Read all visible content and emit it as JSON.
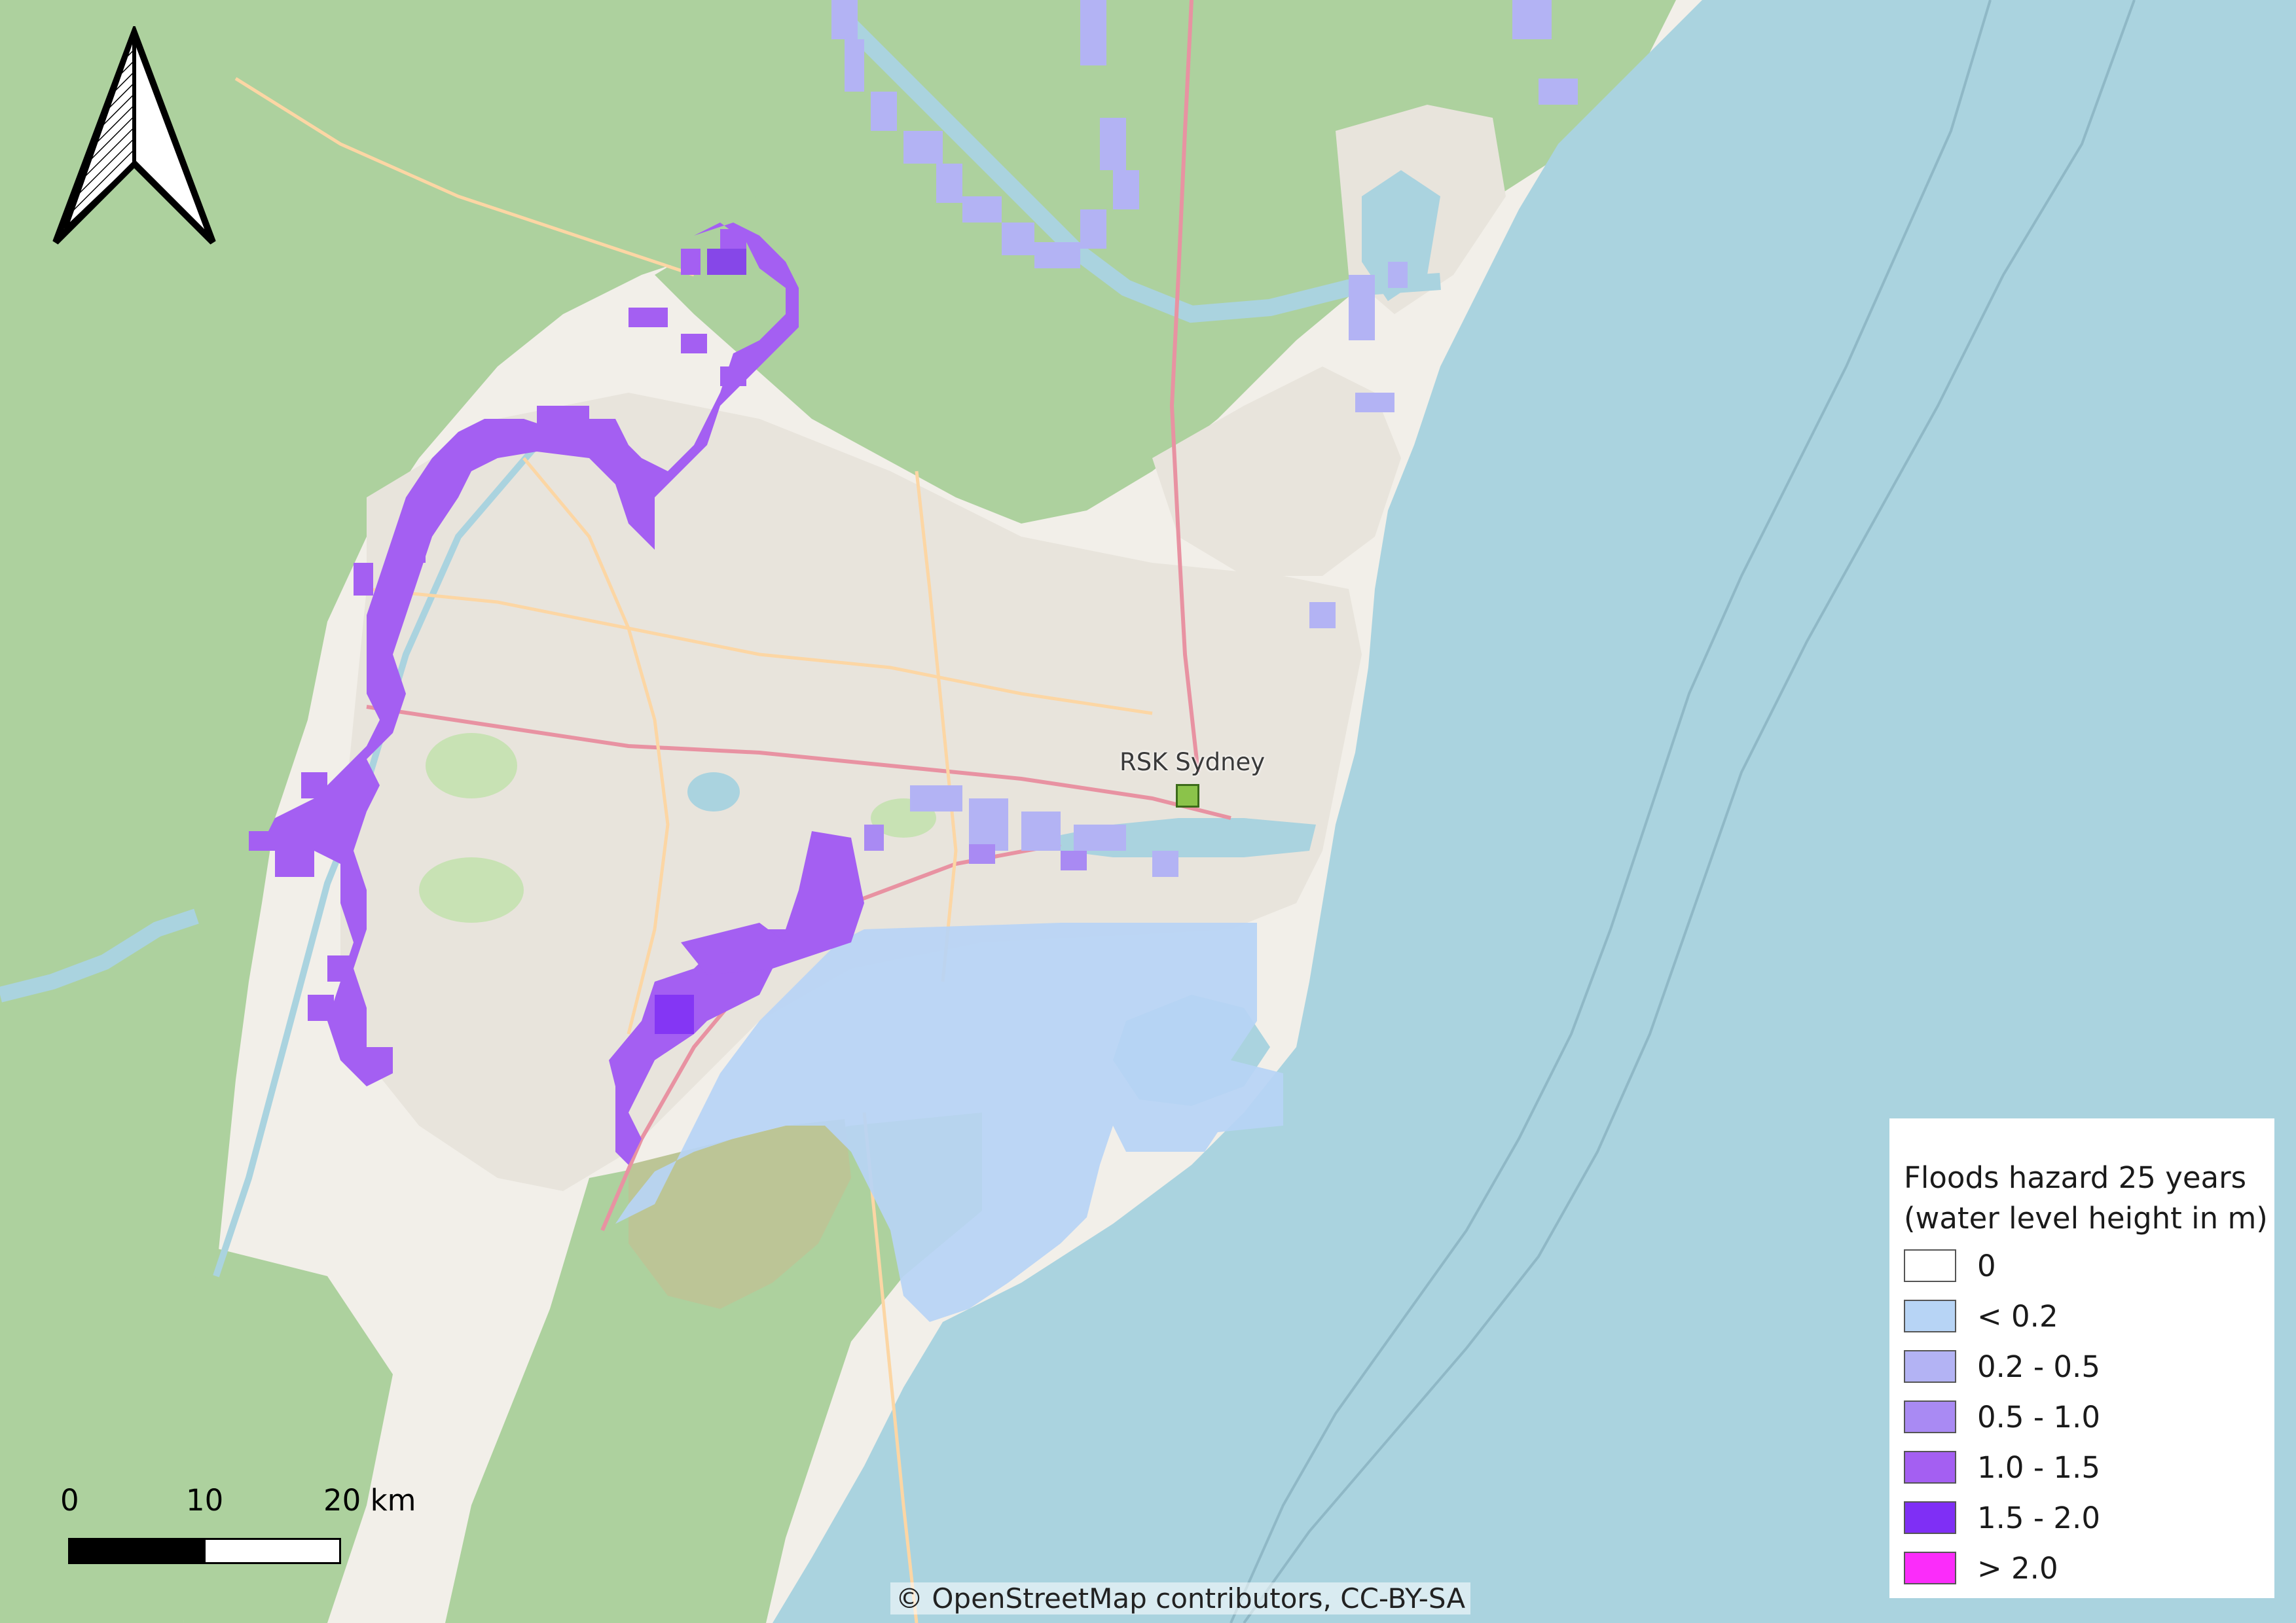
{
  "map": {
    "attribution": "© OpenStreetMap contributors, CC-BY-SA",
    "colors": {
      "ocean": "#aad3df",
      "land_urban": "#e8e4dc",
      "land_rural": "#f2efe9",
      "forest": "#add19e",
      "park": "#c8e2b4",
      "road_major": "#e892a2",
      "road_primary": "#fcd6a4"
    },
    "site": {
      "label": "RSK Sydney",
      "color": "#8bc34a"
    }
  },
  "legend": {
    "title_line1": "Floods hazard 25 years",
    "title_line2": "(water level height in m)",
    "items": [
      {
        "label": "0",
        "color": "#ffffff"
      },
      {
        "label": "< 0.2",
        "color": "#b7d4f5"
      },
      {
        "label": "0.2 - 0.5",
        "color": "#b3b3f4"
      },
      {
        "label": "0.5 - 1.0",
        "color": "#a98af3"
      },
      {
        "label": "1.0 - 1.5",
        "color": "#a45ff2"
      },
      {
        "label": "1.5 - 2.0",
        "color": "#7f2ff5"
      },
      {
        "label": "> 2.0",
        "color": "#fb2cfa"
      }
    ]
  },
  "scalebar": {
    "labels": [
      "0",
      "10",
      "20 km"
    ]
  },
  "north_arrow": {
    "icon": "north-arrow-icon"
  }
}
